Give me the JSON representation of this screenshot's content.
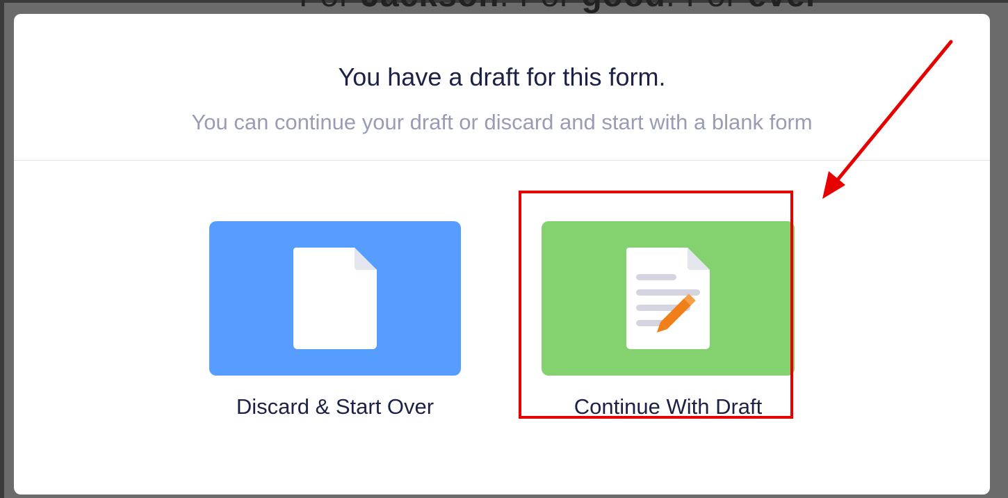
{
  "colors": {
    "blue": "#579dff",
    "green": "#83d16f",
    "annotation_red": "#e60000"
  },
  "backdrop": {
    "text_part1": "For ",
    "text_bold1": "Jackson",
    "text_part2": ". For ",
    "text_bold2": "good",
    "text_part3": ". For ",
    "text_bold3": "ever"
  },
  "modal": {
    "title": "You have a draft for this form.",
    "subtitle": "You can continue your draft or discard and start with a blank form"
  },
  "choices": {
    "discard": {
      "label": "Discard & Start Over",
      "icon": "blank-document-icon"
    },
    "continue": {
      "label": "Continue With Draft",
      "icon": "edit-document-icon"
    }
  }
}
